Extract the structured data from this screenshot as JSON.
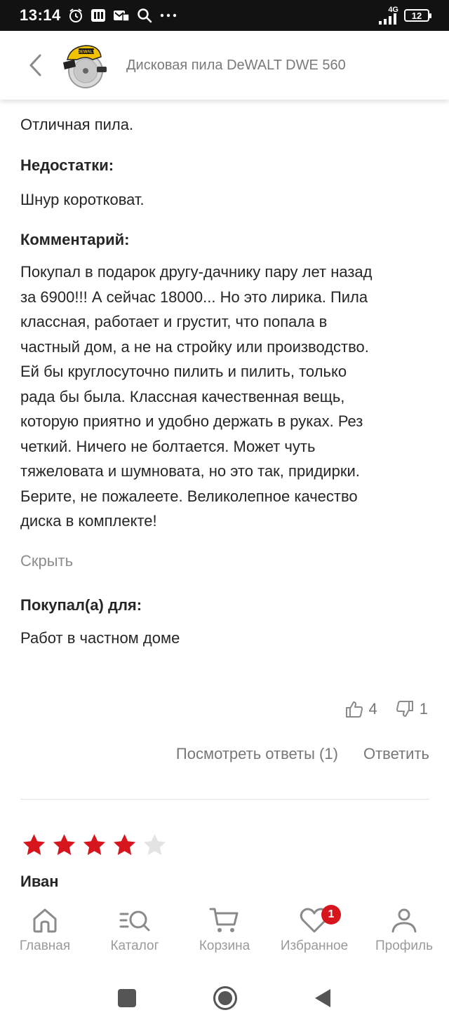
{
  "status_bar": {
    "time": "13:14",
    "network": "4G",
    "battery": "12"
  },
  "header": {
    "title": "Дисковая пила DeWALT DWE 560",
    "thumb_brand": "DEWALT"
  },
  "review": {
    "pros_text": "Отличная пила.",
    "cons_label": "Недостатки:",
    "cons_text": "Шнур коротковат.",
    "comment_label": "Комментарий:",
    "comment_lines": [
      "Покупал в подарок другу-дачнику пару лет назад",
      "за 6900!!! А сейчас 18000... Но это лирика. Пила",
      "классная, работает и грустит, что попала в",
      "частный дом, а не на стройку или производство.",
      "Ей бы круглосуточно пилить и пилить, только",
      "рада бы была. Классная качественная вещь,",
      "которую приятно и удобно держать в руках. Рез",
      "четкий. Ничего не болтается. Может чуть",
      "тяжеловата и шумновата, но это так, придирки.",
      "Берите, не пожалеете. Великолепное качество",
      "диска в комплекте!"
    ],
    "hide_link": "Скрыть",
    "purpose_label": "Покупал(а) для:",
    "purpose_text": "Работ в частном доме",
    "likes": "4",
    "dislikes": "1",
    "view_replies": "Посмотреть ответы (1)",
    "reply": "Ответить"
  },
  "next_review": {
    "rating": 4,
    "max_rating": 5,
    "author": "Иван"
  },
  "bottom_nav": {
    "items": [
      {
        "label": "Главная",
        "icon": "home-icon"
      },
      {
        "label": "Каталог",
        "icon": "catalog-search-icon"
      },
      {
        "label": "Корзина",
        "icon": "cart-icon"
      },
      {
        "label": "Избранное",
        "icon": "heart-icon"
      },
      {
        "label": "Профиль",
        "icon": "profile-icon"
      }
    ],
    "favorites_badge": "1"
  },
  "colors": {
    "star_filled": "#d6161c",
    "star_empty": "#e3e3e3",
    "badge": "#d6161c",
    "muted_text": "#8c8c8c"
  }
}
